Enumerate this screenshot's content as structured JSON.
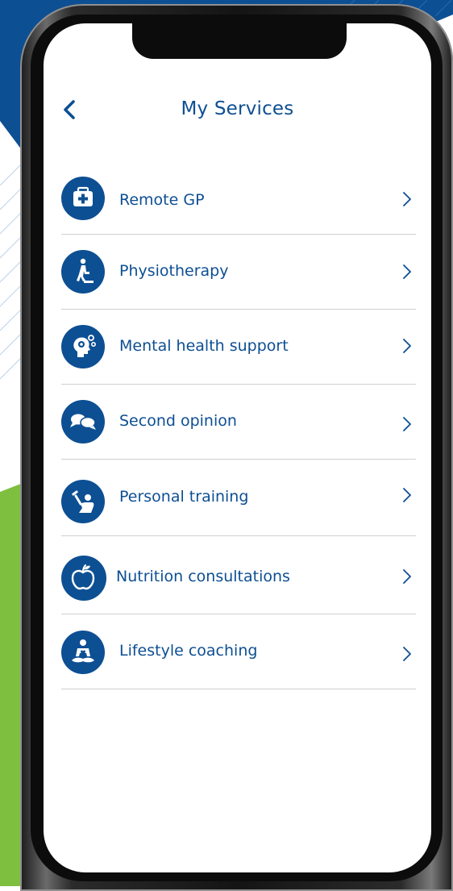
{
  "header": {
    "title": "My Services",
    "back_icon": "chevron-left-icon"
  },
  "services": [
    {
      "label": "Remote GP",
      "icon": "medical-kit-icon"
    },
    {
      "label": "Physiotherapy",
      "icon": "step-exercise-icon"
    },
    {
      "label": "Mental health support",
      "icon": "head-gears-icon"
    },
    {
      "label": "Second opinion",
      "icon": "speech-bubbles-icon"
    },
    {
      "label": "Personal training",
      "icon": "dumbbell-lift-icon"
    },
    {
      "label": "Nutrition consultations",
      "icon": "apple-icon"
    },
    {
      "label": "Lifestyle coaching",
      "icon": "meditation-icon"
    }
  ],
  "colors": {
    "brand_blue": "#0d4f93",
    "accent_green": "#7fbf3f",
    "divider": "#cfcfcf",
    "screen_bg": "#ffffff"
  }
}
